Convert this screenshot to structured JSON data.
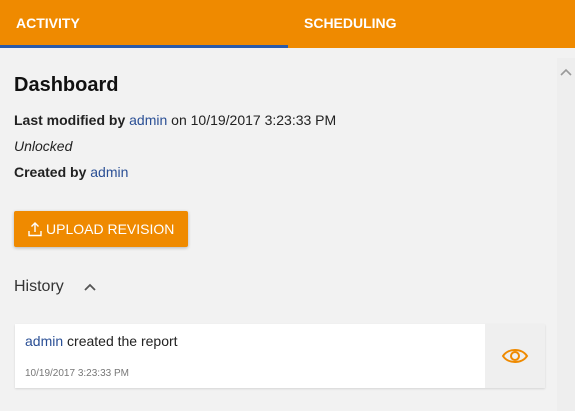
{
  "tabs": {
    "activity": "ACTIVITY",
    "scheduling": "SCHEDULING"
  },
  "page": {
    "title": "Dashboard"
  },
  "meta": {
    "last_modified_label": "Last modified by",
    "last_modified_user": "admin",
    "on_word": "on",
    "last_modified_time": "10/19/2017 3:23:33 PM",
    "lock_status": "Unlocked",
    "created_by_label": "Created by",
    "created_by_user": "admin"
  },
  "actions": {
    "upload_revision": "UPLOAD REVISION"
  },
  "history": {
    "label": "History",
    "items": [
      {
        "user": "admin",
        "action": "created the report",
        "time": "10/19/2017 3:23:33 PM"
      }
    ]
  },
  "colors": {
    "accent": "#ef8a00",
    "link": "#2a4f95",
    "tab_indicator": "#2a5aa8"
  },
  "icons": {
    "upload": "upload-icon",
    "history_toggle": "chevron-up-icon",
    "view": "eye-icon",
    "scroll": "scroll-up-icon"
  }
}
